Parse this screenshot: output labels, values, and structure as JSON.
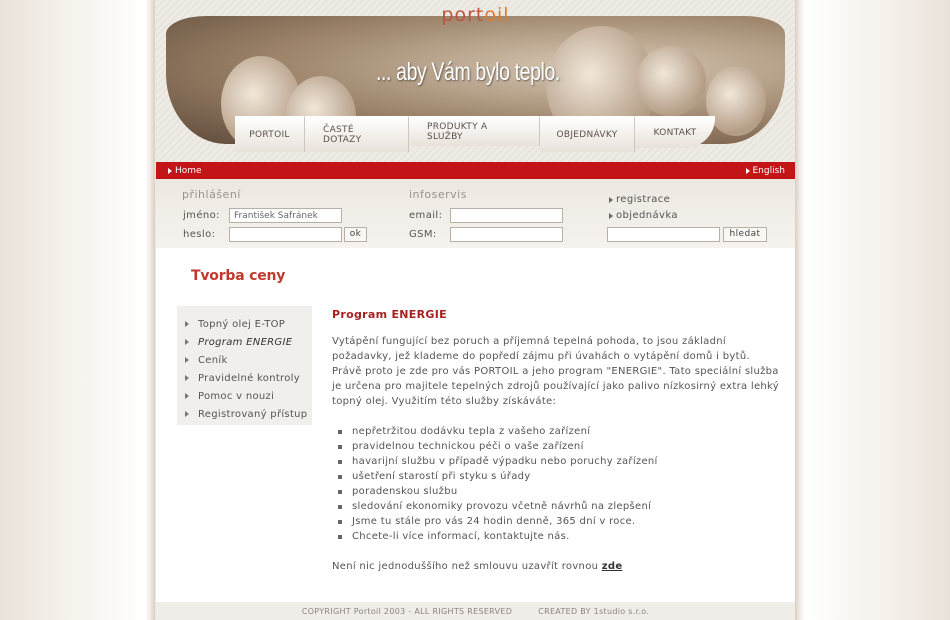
{
  "header": {
    "logo_part1": "port",
    "logo_part2": "oil",
    "slogan": "... aby Vám bylo teplo."
  },
  "nav": [
    {
      "label": "PORTOIL"
    },
    {
      "label": "ČASTÉ DOTAZY"
    },
    {
      "label": "PRODUKTY A SLUŽBY"
    },
    {
      "label": "OBJEDNÁVKY"
    },
    {
      "label": "KONTAKT"
    }
  ],
  "topbar": {
    "home": "Home",
    "english": "English"
  },
  "login": {
    "heading": "přihlášení",
    "name_label": "jméno:",
    "name_value": "František Šafránek",
    "password_label": "heslo:",
    "password_value": "",
    "submit": "ok"
  },
  "infoservis": {
    "heading": "infoservis",
    "email_label": "email:",
    "email_value": "",
    "gsm_label": "GSM:",
    "gsm_value": ""
  },
  "quicklinks": {
    "registration": "registrace",
    "orders": "objednávka",
    "search_value": "",
    "search_button": "hledat"
  },
  "page_title": "Tvorba ceny",
  "sidebar": {
    "items": [
      {
        "label": "Topný olej E-TOP"
      },
      {
        "label": "Program ENERGIE"
      },
      {
        "label": "Ceník"
      },
      {
        "label": "Pravidelné kontroly"
      },
      {
        "label": "Pomoc v nouzi"
      },
      {
        "label": "Registrovaný přístup"
      }
    ]
  },
  "content": {
    "heading": "Program ENERGIE",
    "intro": "Vytápění fungující bez poruch a příjemná tepelná pohoda, to jsou základní požadavky, jež klademe do popředí zájmu při úvahách o vytápění domů i bytů. Právě proto je zde pro vás PORTOIL a jeho program \"ENERGIE\". Tato speciální služba je určena pro majitele tepelných zdrojů používající jako palivo nízkosirný extra lehký topný olej. Využitím této služby získáváte:",
    "bullets": [
      "nepřetržitou dodávku tepla z vašeho zařízení",
      "pravidelnou technickou péči o vaše zařízení",
      "havarijní službu v případě výpadku nebo poruchy zařízení",
      "ušetření starostí při styku s úřady",
      "poradenskou službu",
      "sledování ekonomiky provozu včetně návrhů na zlepšení",
      "Jsme tu stále pro vás 24 hodin denně, 365 dní v roce.",
      "Chcete-li více informací, kontaktujte nás."
    ],
    "closing_text": "Není nic jednoduššího než smlouvu uzavřít rovnou",
    "closing_link": "zde"
  },
  "footer": {
    "copyright": "COPYRIGHT Portoil 2003 - ALL RIGHTS RESERVED",
    "created": "CREATED BY 1studio s.r.o."
  }
}
